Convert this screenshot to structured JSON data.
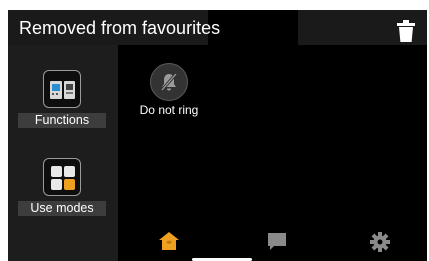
{
  "header": {
    "title": "Removed from favourites",
    "action_icon": "trash-icon"
  },
  "sidebar": {
    "items": [
      {
        "label": "Functions",
        "icon": "functions-icon"
      },
      {
        "label": "Use modes",
        "icon": "use-modes-icon"
      }
    ]
  },
  "favourites": [
    {
      "label": "Do not ring",
      "icon": "bell-off-icon"
    }
  ],
  "bottom_nav": [
    {
      "name": "home",
      "icon": "home-icon",
      "active": true
    },
    {
      "name": "messages",
      "icon": "chat-icon",
      "active": false
    },
    {
      "name": "settings",
      "icon": "gear-icon",
      "active": false
    }
  ],
  "colors": {
    "accent": "#f0a020",
    "inactive_icon": "#8a8a8a",
    "background": "#000000",
    "sidebar": "#1d1d1d"
  }
}
